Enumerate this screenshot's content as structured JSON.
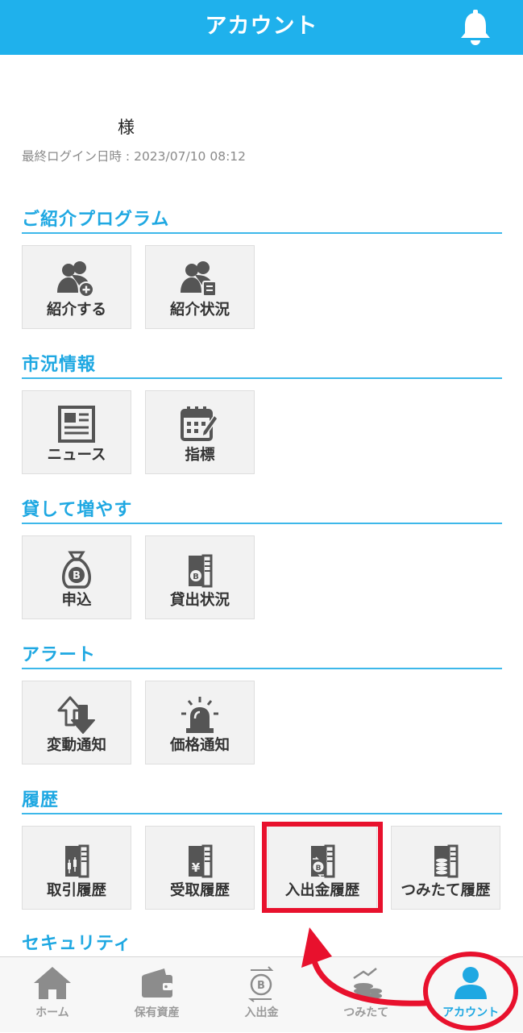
{
  "header": {
    "title": "アカウント"
  },
  "user": {
    "name_suffix": "様",
    "last_login": "最終ログイン日時 : 2023/07/10 08:12"
  },
  "sections": {
    "referral": {
      "title": "ご紹介プログラム",
      "tiles": [
        "紹介する",
        "紹介状況"
      ]
    },
    "market": {
      "title": "市況情報",
      "tiles": [
        "ニュース",
        "指標"
      ]
    },
    "lending": {
      "title": "貸して増やす",
      "tiles": [
        "申込",
        "貸出状況"
      ]
    },
    "alert": {
      "title": "アラート",
      "tiles": [
        "変動通知",
        "価格通知"
      ]
    },
    "history": {
      "title": "履歴",
      "tiles": [
        "取引履歴",
        "受取履歴",
        "入出金履歴",
        "つみたて履歴"
      ]
    },
    "security": {
      "title": "セキュリティ"
    }
  },
  "tabbar": {
    "tabs": [
      "ホーム",
      "保有資産",
      "入出金",
      "つみたて",
      "アカウント"
    ],
    "active": "アカウント"
  },
  "colors": {
    "brand": "#1fb1ec",
    "section_text": "#1fa8e2",
    "highlight": "#e8112d",
    "icon": "#555555"
  }
}
